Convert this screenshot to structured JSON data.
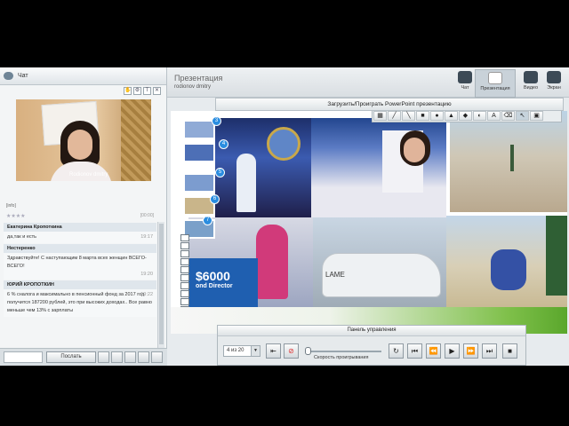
{
  "chat": {
    "title": "Чат",
    "video_caption": "Rodionov dmitry",
    "video_label": "[info]",
    "stars": "★★★★",
    "stars_time": "[00:00]",
    "messages": [
      {
        "name": "Екатерина Кропоткина",
        "text": "да,так и есть",
        "time": "19:17"
      },
      {
        "name": "Нестеренко",
        "text": "Здравствуйте! С наступающим 8 марта всех женщин ВСЕГО-ВСЕГО!",
        "time": "19:20"
      },
      {
        "name": "ЮРИЙ КРОПОТКИН",
        "text": "6 % сналога и максимально в пенсионный фонд за 2017 год получится  187200 рублей, это при высоких доходах.. Все равно меньше чем 13% с зарплаты",
        "time": "19:22"
      }
    ],
    "send_label": "Послать"
  },
  "presentation": {
    "title": "Презентация",
    "user": "rodionov dmitry",
    "upload_label": "Загрузить/Проиграть PowerPoint презентацию",
    "modes": [
      {
        "label": "Чат",
        "icon": "chat-bubble-icon",
        "active": false
      },
      {
        "label": "Презентация",
        "icon": "presentation-board-icon",
        "active": true
      },
      {
        "label": "Видео",
        "icon": "video-camera-icon",
        "active": false
      },
      {
        "label": "Экран",
        "icon": "screen-monitor-icon",
        "active": false
      }
    ],
    "thumb_numbers": [
      "3",
      "4",
      "5",
      "6",
      "7"
    ],
    "slide_text": {
      "big": "$6000",
      "small": "ond Director",
      "car": "LAME"
    }
  },
  "control_panel": {
    "title": "Панель управления",
    "slide_counter": "4 из 20",
    "speed_label": "Скорость проигрывания"
  },
  "colors": {
    "accent": "#2a8de0",
    "green": "#5aa72c"
  }
}
